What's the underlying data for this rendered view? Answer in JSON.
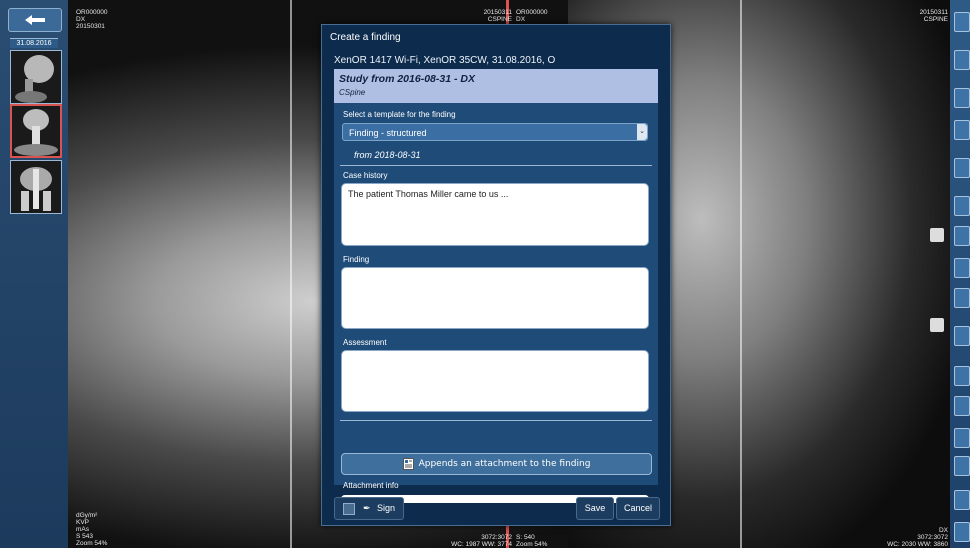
{
  "left_panel": {
    "back_icon": "arrow-left-icon",
    "date": "31.08.2016",
    "thumbnails": [
      {
        "name": "thumb-lateral-cspine"
      },
      {
        "name": "thumb-ap-cspine"
      },
      {
        "name": "thumb-ap-pelvis"
      }
    ]
  },
  "overlays": {
    "top_left": [
      "OR000000",
      "DX",
      "20150301"
    ],
    "top_center_left": [
      "20150311",
      "CSPINE"
    ],
    "top_center_right": [
      "OR000000",
      "DX"
    ],
    "top_right": [
      "20150311",
      "CSPINE"
    ],
    "bottom_left": [
      "dGy/m²",
      "KVP",
      "mAs",
      "S 543",
      "Zoom 54%"
    ],
    "bottom_center_left": [
      "3072:3072",
      "WC: 1987 WW: 3774"
    ],
    "bottom_center_right": [
      "S: 540",
      "Zoom 54%"
    ],
    "bottom_right": [
      "DX",
      "3072:3072",
      "WC: 2030 WW: 3860"
    ]
  },
  "dialog": {
    "title": "Create a finding",
    "subtitle": "XenOR 1417 Wi-Fi, XenOR 35CW, 31.08.2016, O",
    "study_title": "Study from 2016-08-31 - DX",
    "study_sub": "CSpine",
    "template_label": "Select a template for the finding",
    "template_value": "Finding - structured",
    "template_date": "from 2018-08-31",
    "case_history_label": "Case history",
    "case_history_value": "The patient Thomas Miller came to us ...",
    "finding_label": "Finding",
    "finding_value": "",
    "assessment_label": "Assessment",
    "assessment_value": "",
    "attach_button": "Appends an attachment to the finding",
    "attachment_info_label": "Attachment info",
    "sign_label": "Sign",
    "save_label": "Save",
    "cancel_label": "Cancel"
  },
  "colors": {
    "dialog_bg": "#0d2b4d",
    "form_bg": "#1e4b78",
    "study_box_bg": "#aebfe3",
    "sidebar_bg": "#2a4d72"
  }
}
